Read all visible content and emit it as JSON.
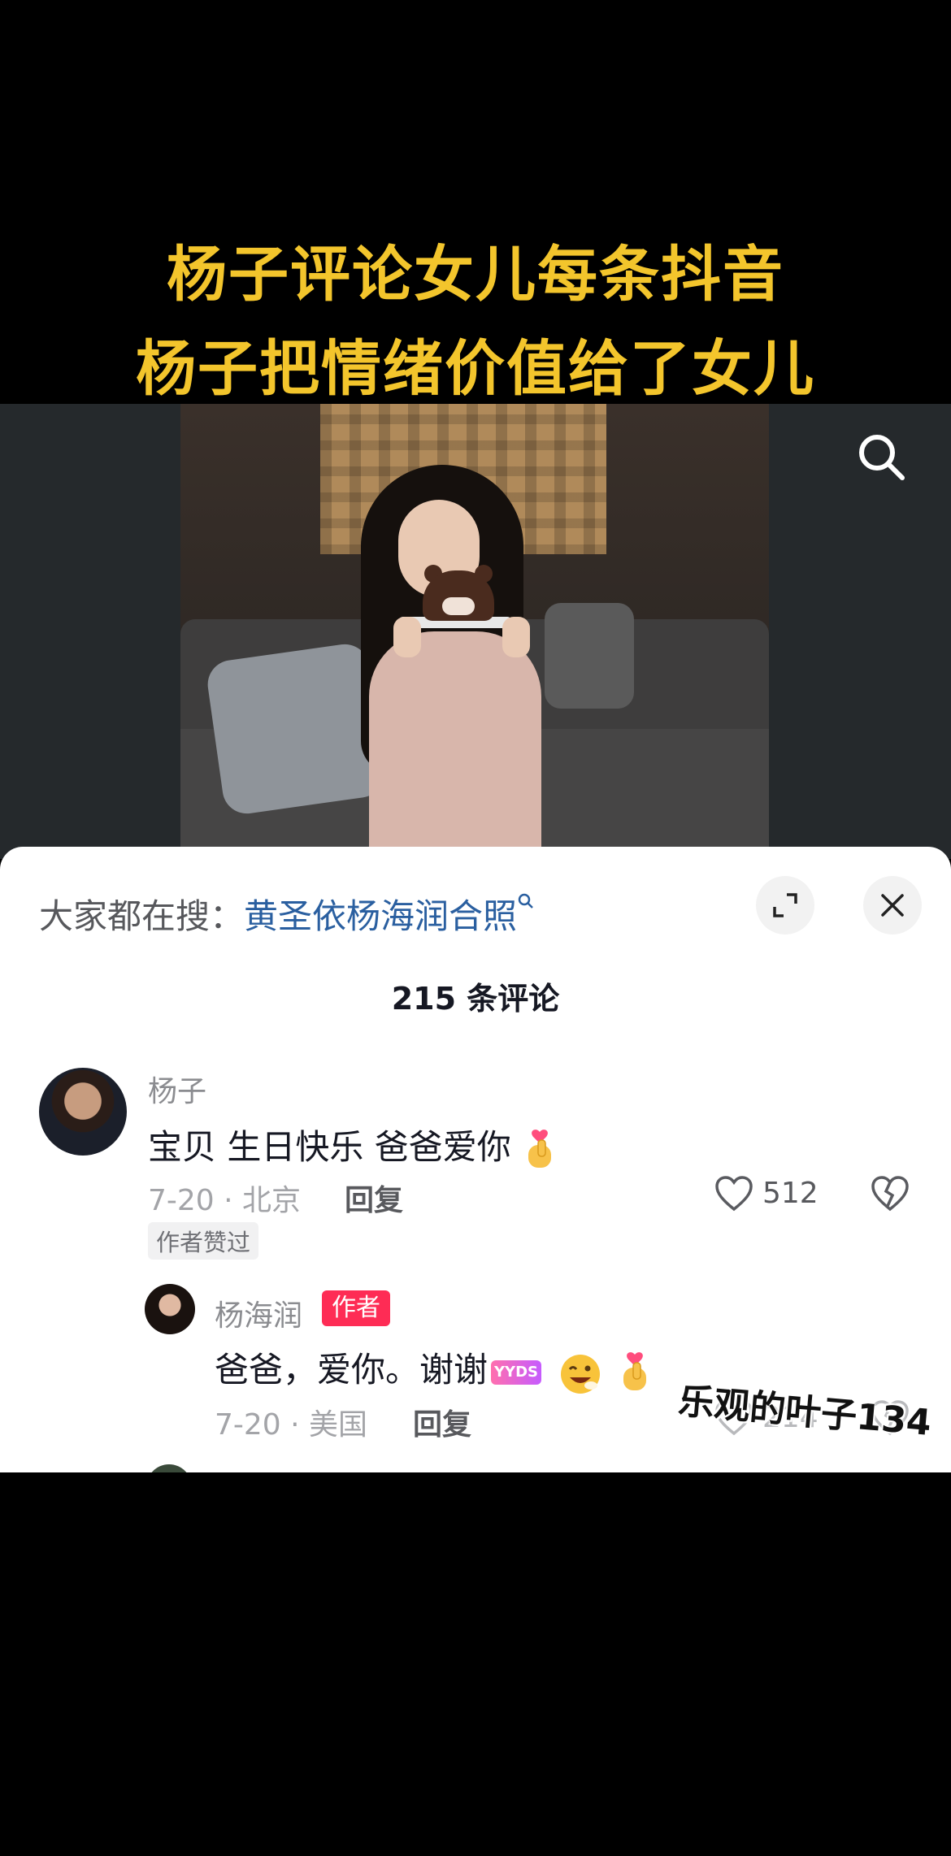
{
  "headline": {
    "line1": "杨子评论女儿每条抖音",
    "line2": "杨子把情绪价值给了女儿"
  },
  "video": {
    "search_icon": "search-icon"
  },
  "sheet": {
    "hot_search_prefix": "大家都在搜：",
    "hot_search_term": "黄圣依杨海润合照",
    "expand_icon": "expand-icon",
    "close_icon": "close-icon",
    "comment_count": "215 条评论"
  },
  "comments": [
    {
      "author": "杨子",
      "text": "宝贝 生日快乐 爸爸爱你",
      "emoji": "finger-heart",
      "time_location": "7-20 · 北京",
      "reply_label": "回复",
      "likes": "512",
      "badge": "作者赞过"
    }
  ],
  "replies": [
    {
      "author": "杨海润",
      "author_tag": "作者",
      "text": "爸爸，爱你。谢谢",
      "sticker_text": "YYDS",
      "emojis": [
        "winking-face",
        "finger-heart"
      ],
      "time_location": "7-20 · 美国",
      "reply_label": "回复",
      "likes": "214"
    }
  ],
  "watermark": "乐观的叶子134",
  "colors": {
    "headline": "#f3c52c",
    "link": "#2a5fa0",
    "author_tag": "#fe2c55"
  }
}
